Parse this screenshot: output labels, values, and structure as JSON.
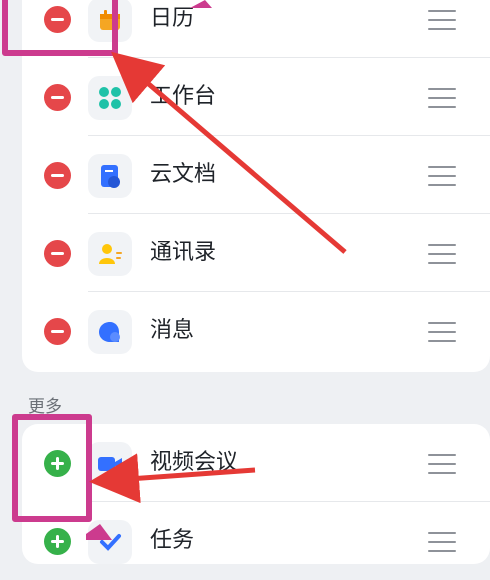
{
  "enabled_apps": [
    {
      "label": "日历",
      "icon": "calendar-icon"
    },
    {
      "label": "工作台",
      "icon": "workbench-icon"
    },
    {
      "label": "云文档",
      "icon": "cloud-docs-icon"
    },
    {
      "label": "通讯录",
      "icon": "contacts-icon"
    },
    {
      "label": "消息",
      "icon": "messages-icon"
    }
  ],
  "more_section": {
    "title": "更多",
    "apps": [
      {
        "label": "视频会议",
        "icon": "video-meeting-icon"
      },
      {
        "label": "任务",
        "icon": "tasks-icon"
      }
    ]
  },
  "colors": {
    "remove": "#e5474a",
    "add": "#36b14a",
    "annotation": "#cc3b8e",
    "arrow": "#e53935"
  }
}
